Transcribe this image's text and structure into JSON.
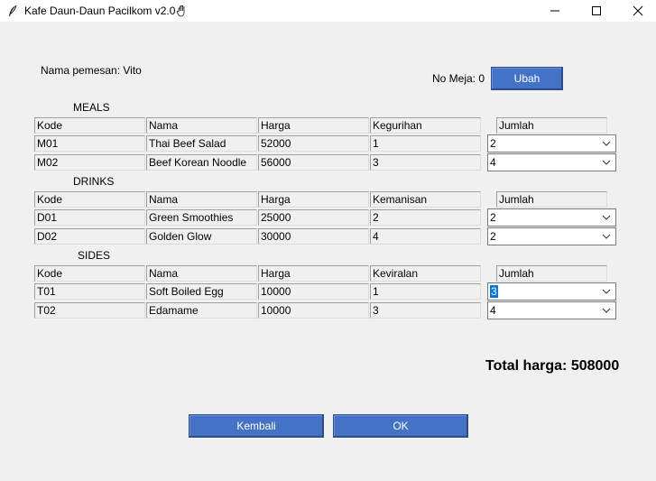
{
  "window": {
    "title": "Kafe Daun-Daun Pacilkom v2.0",
    "icon": "feather-icon",
    "emoji_icon": "hand-icon",
    "controls": [
      "minimize-icon",
      "maximize-icon",
      "close-icon"
    ]
  },
  "header": {
    "customer_label": "Nama pemesan: Vito",
    "table_label": "No Meja: 0",
    "change_button": "Ubah"
  },
  "columns": {
    "kode": "Kode",
    "nama": "Nama",
    "harga": "Harga",
    "jumlah": "Jumlah"
  },
  "sections": [
    {
      "title": "MEALS",
      "attr": "Kegurihan",
      "rows": [
        {
          "kode": "M01",
          "nama": "Thai Beef Salad",
          "harga": "52000",
          "attr": "1",
          "jumlah": "2"
        },
        {
          "kode": "M02",
          "nama": "Beef Korean Noodle",
          "harga": "56000",
          "attr": "3",
          "jumlah": "4"
        }
      ]
    },
    {
      "title": "DRINKS",
      "attr": "Kemanisan",
      "rows": [
        {
          "kode": "D01",
          "nama": "Green Smoothies",
          "harga": "25000",
          "attr": "2",
          "jumlah": "2"
        },
        {
          "kode": "D02",
          "nama": "Golden Glow",
          "harga": "30000",
          "attr": "4",
          "jumlah": "2"
        }
      ]
    },
    {
      "title": "SIDES",
      "attr": "Keviralan",
      "rows": [
        {
          "kode": "T01",
          "nama": "Soft Boiled Egg",
          "harga": "10000",
          "attr": "1",
          "jumlah": "3"
        },
        {
          "kode": "T02",
          "nama": "Edamame",
          "harga": "10000",
          "attr": "3",
          "jumlah": "4"
        }
      ]
    }
  ],
  "total": "Total harga: 508000",
  "buttons": {
    "back": "Kembali",
    "ok": "OK"
  },
  "colors": {
    "accent": "#4472c4",
    "background": "#f0f0f0",
    "selection": "#0078d7"
  }
}
